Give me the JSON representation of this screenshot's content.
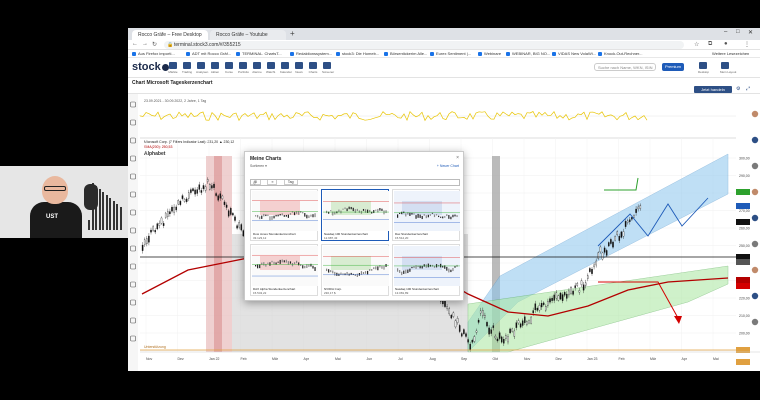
{
  "browser": {
    "tabs": [
      {
        "label": "Rocco Gräfe – Free Desktop"
      },
      {
        "label": "Rocco Gräfe – Youtube"
      }
    ],
    "new_tab": "+",
    "url": "terminal.stock3.com/#/355215",
    "bookmarks": [
      "Aus Firefox importi...",
      "ADT mit Rocco Gräf...",
      "TERMINAL. ChartsT...",
      "Redaktionssystem...",
      "stock3: Die Homeb...",
      "Börsentickerim Alle...",
      "Eurex Sentiment |...",
      "Webinare",
      "WEBINAR, BIG NO...",
      "VIDAS New VolaWi...",
      "Knock-Out-Rechner..."
    ],
    "bookmarks_more": "Weitere Lesezeichen"
  },
  "app": {
    "logo": "stock",
    "nav": [
      "Märkte",
      "Trading",
      "Analysen",
      "Aktien",
      "Kurse",
      "Portfolio",
      "Alarme",
      "Watchl.",
      "Kalender",
      "News",
      "Charts",
      "Screener"
    ],
    "search_placeholder": "Suche nach Name, WKN, ISIN",
    "premium_label": "Premium",
    "right_labels": [
      "Desktop",
      "Mein Layout"
    ]
  },
  "chart": {
    "title": "Chart Microsoft Tageskerzenchart",
    "buttons": [
      "Chart",
      "Marc.",
      "Neues",
      "Tit",
      "2 Jahre",
      "1 Jahr",
      "Indikat.",
      "Vergl.",
      "Zeichnen"
    ],
    "trade_button": "Jetzt handeln",
    "instrument_label": "Alphabet",
    "date_range": "23.09.2021 - 30.09.2022, 2 Jahre, 1 Tag",
    "legend_1": "Microsoft Corp. (7 Filters Indicator Last): 231,20 ▲ 230,12",
    "legend_2": "SMA(200): 250,53",
    "support_label_1": "Unterstützung",
    "support_label_2": "Unterstützung",
    "price_labels": [
      "300,00",
      "290,00",
      "280,00",
      "270,00",
      "260,00",
      "250,00",
      "240,00",
      "230,00",
      "220,00",
      "210,00",
      "200,00",
      "190,00"
    ],
    "time_labels": [
      "Nov",
      "Dez",
      "Jan 22",
      "Feb",
      "Mär",
      "Apr",
      "Mai",
      "Jun",
      "Jul",
      "Aug",
      "Sep",
      "Okt",
      "Nov",
      "Dez",
      "Jan 23",
      "Feb",
      "Mär",
      "Apr",
      "Mai"
    ]
  },
  "popup": {
    "title": "Meine Charts",
    "close": "×",
    "sort": "Sortieren ▾",
    "new_chart": "+ Neuer Chart",
    "tools": [
      "⊞",
      "≡",
      "Tag"
    ],
    "search_placeholder": "Q",
    "cards": [
      {
        "name": "Dow Jones Stundenkerzenchart",
        "value": "33.123,12"
      },
      {
        "name": "Nasdaq 100 Stundenkerzenchart",
        "value": "12.987,43"
      },
      {
        "name": "Dax Stundenkerzenchart",
        "value": "15.512,20"
      },
      {
        "name": "DAX Alpha Stundenkerzenchart",
        "value": "15.543,22"
      },
      {
        "name": "NVIDIA Corp.",
        "value": "230,17 $"
      },
      {
        "name": "Nasdaq 100 Stundenkerzenchart",
        "value": "13.081,89"
      }
    ]
  },
  "colors": {
    "channel_blue": "#8cc6ee",
    "channel_green": "#a9e7a0",
    "sma_red": "#b30000",
    "arrow_red": "#d40000",
    "support_orange": "#e0a040",
    "brand": "#1b2a4a"
  }
}
